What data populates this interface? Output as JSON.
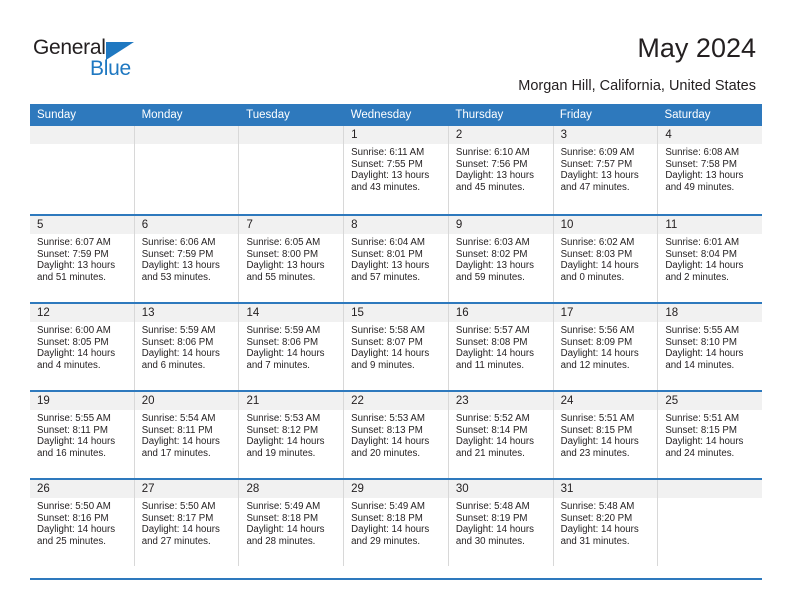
{
  "brand": {
    "name_dark": "General",
    "name_blue": "Blue",
    "accent_color": "#1f78c1"
  },
  "header": {
    "title": "May 2024",
    "location": "Morgan Hill, California, United States"
  },
  "colors": {
    "header_blue": "#2e79bd",
    "daynum_band": "#f1f1f1",
    "cell_border": "#d8d8d8",
    "text": "#231f20"
  },
  "calendar": {
    "weekdays": [
      "Sunday",
      "Monday",
      "Tuesday",
      "Wednesday",
      "Thursday",
      "Friday",
      "Saturday"
    ],
    "weeks": [
      [
        {
          "day": "",
          "lines": []
        },
        {
          "day": "",
          "lines": []
        },
        {
          "day": "",
          "lines": []
        },
        {
          "day": "1",
          "lines": [
            "Sunrise: 6:11 AM",
            "Sunset: 7:55 PM",
            "Daylight: 13 hours",
            "and 43 minutes."
          ]
        },
        {
          "day": "2",
          "lines": [
            "Sunrise: 6:10 AM",
            "Sunset: 7:56 PM",
            "Daylight: 13 hours",
            "and 45 minutes."
          ]
        },
        {
          "day": "3",
          "lines": [
            "Sunrise: 6:09 AM",
            "Sunset: 7:57 PM",
            "Daylight: 13 hours",
            "and 47 minutes."
          ]
        },
        {
          "day": "4",
          "lines": [
            "Sunrise: 6:08 AM",
            "Sunset: 7:58 PM",
            "Daylight: 13 hours",
            "and 49 minutes."
          ]
        }
      ],
      [
        {
          "day": "5",
          "lines": [
            "Sunrise: 6:07 AM",
            "Sunset: 7:59 PM",
            "Daylight: 13 hours",
            "and 51 minutes."
          ]
        },
        {
          "day": "6",
          "lines": [
            "Sunrise: 6:06 AM",
            "Sunset: 7:59 PM",
            "Daylight: 13 hours",
            "and 53 minutes."
          ]
        },
        {
          "day": "7",
          "lines": [
            "Sunrise: 6:05 AM",
            "Sunset: 8:00 PM",
            "Daylight: 13 hours",
            "and 55 minutes."
          ]
        },
        {
          "day": "8",
          "lines": [
            "Sunrise: 6:04 AM",
            "Sunset: 8:01 PM",
            "Daylight: 13 hours",
            "and 57 minutes."
          ]
        },
        {
          "day": "9",
          "lines": [
            "Sunrise: 6:03 AM",
            "Sunset: 8:02 PM",
            "Daylight: 13 hours",
            "and 59 minutes."
          ]
        },
        {
          "day": "10",
          "lines": [
            "Sunrise: 6:02 AM",
            "Sunset: 8:03 PM",
            "Daylight: 14 hours",
            "and 0 minutes."
          ]
        },
        {
          "day": "11",
          "lines": [
            "Sunrise: 6:01 AM",
            "Sunset: 8:04 PM",
            "Daylight: 14 hours",
            "and 2 minutes."
          ]
        }
      ],
      [
        {
          "day": "12",
          "lines": [
            "Sunrise: 6:00 AM",
            "Sunset: 8:05 PM",
            "Daylight: 14 hours",
            "and 4 minutes."
          ]
        },
        {
          "day": "13",
          "lines": [
            "Sunrise: 5:59 AM",
            "Sunset: 8:06 PM",
            "Daylight: 14 hours",
            "and 6 minutes."
          ]
        },
        {
          "day": "14",
          "lines": [
            "Sunrise: 5:59 AM",
            "Sunset: 8:06 PM",
            "Daylight: 14 hours",
            "and 7 minutes."
          ]
        },
        {
          "day": "15",
          "lines": [
            "Sunrise: 5:58 AM",
            "Sunset: 8:07 PM",
            "Daylight: 14 hours",
            "and 9 minutes."
          ]
        },
        {
          "day": "16",
          "lines": [
            "Sunrise: 5:57 AM",
            "Sunset: 8:08 PM",
            "Daylight: 14 hours",
            "and 11 minutes."
          ]
        },
        {
          "day": "17",
          "lines": [
            "Sunrise: 5:56 AM",
            "Sunset: 8:09 PM",
            "Daylight: 14 hours",
            "and 12 minutes."
          ]
        },
        {
          "day": "18",
          "lines": [
            "Sunrise: 5:55 AM",
            "Sunset: 8:10 PM",
            "Daylight: 14 hours",
            "and 14 minutes."
          ]
        }
      ],
      [
        {
          "day": "19",
          "lines": [
            "Sunrise: 5:55 AM",
            "Sunset: 8:11 PM",
            "Daylight: 14 hours",
            "and 16 minutes."
          ]
        },
        {
          "day": "20",
          "lines": [
            "Sunrise: 5:54 AM",
            "Sunset: 8:11 PM",
            "Daylight: 14 hours",
            "and 17 minutes."
          ]
        },
        {
          "day": "21",
          "lines": [
            "Sunrise: 5:53 AM",
            "Sunset: 8:12 PM",
            "Daylight: 14 hours",
            "and 19 minutes."
          ]
        },
        {
          "day": "22",
          "lines": [
            "Sunrise: 5:53 AM",
            "Sunset: 8:13 PM",
            "Daylight: 14 hours",
            "and 20 minutes."
          ]
        },
        {
          "day": "23",
          "lines": [
            "Sunrise: 5:52 AM",
            "Sunset: 8:14 PM",
            "Daylight: 14 hours",
            "and 21 minutes."
          ]
        },
        {
          "day": "24",
          "lines": [
            "Sunrise: 5:51 AM",
            "Sunset: 8:15 PM",
            "Daylight: 14 hours",
            "and 23 minutes."
          ]
        },
        {
          "day": "25",
          "lines": [
            "Sunrise: 5:51 AM",
            "Sunset: 8:15 PM",
            "Daylight: 14 hours",
            "and 24 minutes."
          ]
        }
      ],
      [
        {
          "day": "26",
          "lines": [
            "Sunrise: 5:50 AM",
            "Sunset: 8:16 PM",
            "Daylight: 14 hours",
            "and 25 minutes."
          ]
        },
        {
          "day": "27",
          "lines": [
            "Sunrise: 5:50 AM",
            "Sunset: 8:17 PM",
            "Daylight: 14 hours",
            "and 27 minutes."
          ]
        },
        {
          "day": "28",
          "lines": [
            "Sunrise: 5:49 AM",
            "Sunset: 8:18 PM",
            "Daylight: 14 hours",
            "and 28 minutes."
          ]
        },
        {
          "day": "29",
          "lines": [
            "Sunrise: 5:49 AM",
            "Sunset: 8:18 PM",
            "Daylight: 14 hours",
            "and 29 minutes."
          ]
        },
        {
          "day": "30",
          "lines": [
            "Sunrise: 5:48 AM",
            "Sunset: 8:19 PM",
            "Daylight: 14 hours",
            "and 30 minutes."
          ]
        },
        {
          "day": "31",
          "lines": [
            "Sunrise: 5:48 AM",
            "Sunset: 8:20 PM",
            "Daylight: 14 hours",
            "and 31 minutes."
          ]
        },
        {
          "day": "",
          "lines": []
        }
      ]
    ]
  }
}
